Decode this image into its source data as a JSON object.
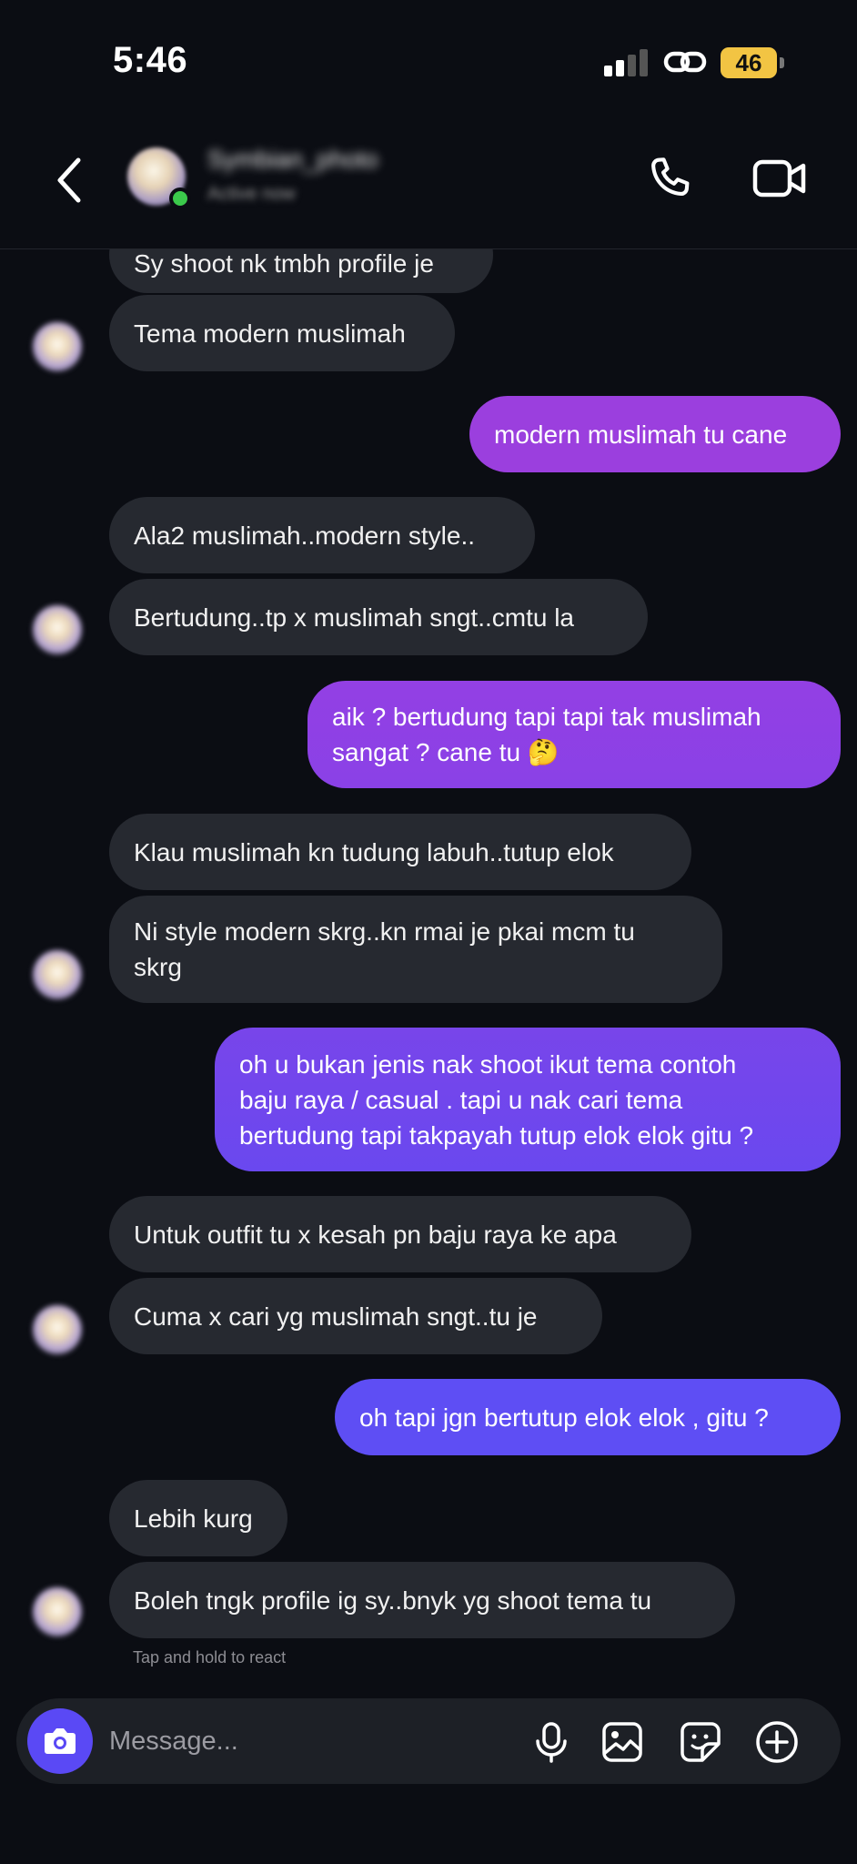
{
  "status_bar": {
    "time": "5:46",
    "battery": "46"
  },
  "header": {
    "contact_name": "Symbian_photo",
    "contact_status": "Active now"
  },
  "messages": [
    {
      "dir": "in",
      "text": "Sy shoot nk tmbh profile je"
    },
    {
      "dir": "in",
      "text": "Tema modern muslimah"
    },
    {
      "dir": "out",
      "text": "modern muslimah tu cane"
    },
    {
      "dir": "in",
      "text": "Ala2 muslimah..modern style.."
    },
    {
      "dir": "in",
      "text": "Bertudung..tp x muslimah sngt..cmtu la"
    },
    {
      "dir": "out",
      "text": "aik ? bertudung tapi tapi tak muslimah\nsangat ? cane tu 🤔"
    },
    {
      "dir": "in",
      "text": "Klau muslimah kn tudung labuh..tutup elok"
    },
    {
      "dir": "in",
      "text": "Ni style modern skrg..kn rmai je pkai mcm tu\nskrg"
    },
    {
      "dir": "out",
      "text": "oh u bukan jenis nak shoot ikut tema contoh\nbaju raya / casual . tapi u nak cari tema\nbertudung tapi takpayah tutup elok elok gitu ?"
    },
    {
      "dir": "in",
      "text": "Untuk outfit tu x kesah pn baju raya ke apa"
    },
    {
      "dir": "in",
      "text": "Cuma x cari yg muslimah sngt..tu je"
    },
    {
      "dir": "out",
      "text": "oh tapi jgn bertutup elok elok , gitu ?"
    },
    {
      "dir": "in",
      "text": "Lebih kurg"
    },
    {
      "dir": "in",
      "text": "Boleh tngk profile ig sy..bnyk yg shoot tema tu"
    }
  ],
  "hint": "Tap and hold to react",
  "composer": {
    "placeholder": "Message..."
  },
  "colors": {
    "background": "#0b0d13",
    "incoming_bubble": "#262930",
    "outgoing_top": "#9b3fde",
    "outgoing_bottom": "#5e4ef4",
    "online": "#3bc94b",
    "camera_button": "#5a49f5",
    "battery": "#f2c443"
  }
}
